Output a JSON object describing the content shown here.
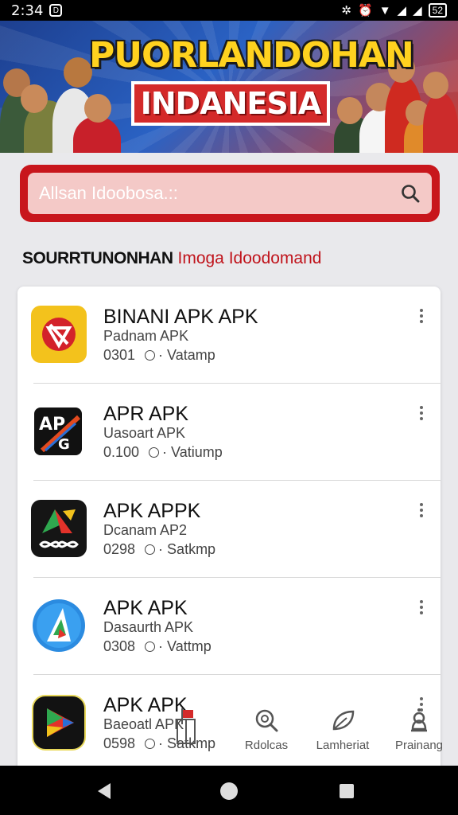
{
  "status_bar": {
    "time": "2:34",
    "notification_badge": "D",
    "battery": "52"
  },
  "banner": {
    "title_line1": "PUORLANDOHAN",
    "title_line2": "INDANESIA"
  },
  "search": {
    "placeholder": "Allsan Idoobosa.::"
  },
  "section": {
    "heading_bold": "SOURRTUNONHAN",
    "heading_red": "Imoga Idoodomand"
  },
  "apps": [
    {
      "name": "BINANI APK APK",
      "subtitle": "Padnam APK",
      "size": "0301",
      "status": "Vatamp",
      "icon": "binance-style-red-on-yellow-icon"
    },
    {
      "name": "APR APK",
      "subtitle": "Uasoart APK",
      "size": "0.100",
      "status": "Vatiump",
      "icon": "apk-x-logo-icon"
    },
    {
      "name": "APK APPK",
      "subtitle": "Dcanam AP2",
      "size": "0298",
      "status": "Satkmp",
      "icon": "green-red-a-infinity-icon"
    },
    {
      "name": "APK APK",
      "subtitle": "Dasaurth APK",
      "size": "0308",
      "status": "Vattmp",
      "icon": "blue-a-play-icon"
    },
    {
      "name": "APK APK",
      "subtitle": "Baeoatl APK",
      "size": "0598",
      "status": "Satkmp",
      "icon": "play-store-triangle-icon"
    }
  ],
  "bottom_nav": [
    {
      "label": "",
      "icon": "gift-flag-icon"
    },
    {
      "label": "Rdolcas",
      "icon": "search-zoom-icon"
    },
    {
      "label": "Lamheriat",
      "icon": "leaf-edit-icon"
    },
    {
      "label": "Prainang",
      "icon": "person-bell-icon"
    }
  ],
  "colors": {
    "accent_red": "#c8161c",
    "search_fill": "#f4c9c7",
    "banner_yellow": "#ffd21f"
  }
}
